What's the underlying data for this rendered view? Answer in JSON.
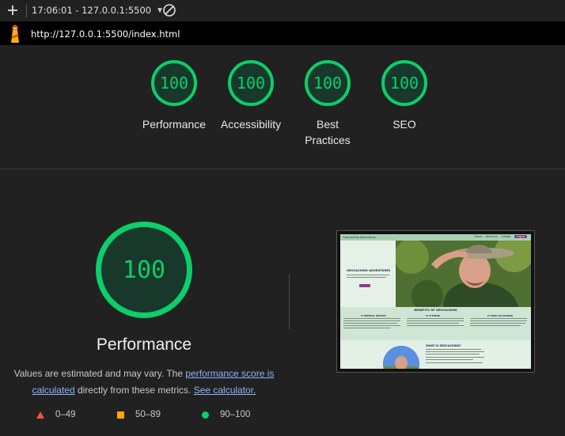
{
  "toolbar": {
    "new_report_icon": "plus-icon",
    "report_label": "17:06:01 - 127.0.0.1:5500",
    "dropdown_icon": "caret-down-icon",
    "clear_icon": "block-icon"
  },
  "urlbar": {
    "logo_icon": "lighthouse-icon",
    "url": "http://127.0.0.1:5500/index.html"
  },
  "categories": [
    {
      "label": "Performance",
      "score": "100"
    },
    {
      "label": "Accessibility",
      "score": "100"
    },
    {
      "label": "Best Practices",
      "score": "100"
    },
    {
      "label": "SEO",
      "score": "100"
    }
  ],
  "performance": {
    "score": "100",
    "title": "Performance",
    "desc_prefix": "Values are estimated and may vary. The ",
    "link_score": "performance score is calculated",
    "desc_middle": " directly from these metrics. ",
    "link_calc": "See calculator.",
    "legend": {
      "fail": "0–49",
      "average": "50–89",
      "pass": "90–100"
    }
  },
  "thumbnail": {
    "brand": "Geocaching Adventures",
    "nav": [
      "Home",
      "About Us",
      "Contact",
      "Log In"
    ],
    "hero_title": "GEOCACHING ADVENTURES",
    "benefits_title": "BENEFITS OF GEOCACHING",
    "benefit_cols": [
      "IT MENTAL HEALTH",
      "IT FITNESS",
      "IT NEW LOCATIONS"
    ],
    "what_title": "WHAT IS GEOCACHING?"
  },
  "colors": {
    "pass": "#0cce6b",
    "average": "#ffa400",
    "fail": "#ff4e42",
    "background": "#212121",
    "link": "#8ab4f8"
  }
}
